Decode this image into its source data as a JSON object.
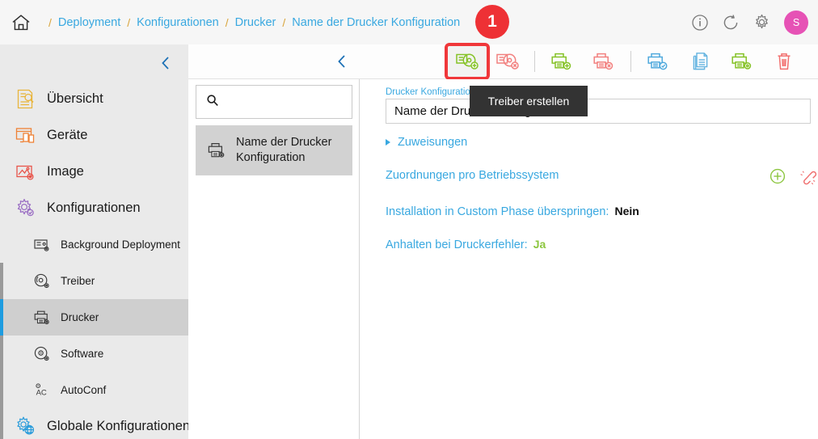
{
  "header": {
    "home_icon": "home-icon",
    "breadcrumb": [
      {
        "label": "Deployment"
      },
      {
        "label": "Konfigurationen"
      },
      {
        "label": "Drucker"
      },
      {
        "label": "Name der Drucker Konfiguration"
      }
    ],
    "separator": "/",
    "actions": [
      {
        "name": "info-icon",
        "title": "Info"
      },
      {
        "name": "refresh-icon",
        "title": "Refresh"
      },
      {
        "name": "gear-icon",
        "title": "Settings"
      }
    ],
    "avatar_initial": "S",
    "avatar_color": "#e652b5",
    "background": "#f6f6f6",
    "link_color": "#39a8e0",
    "separator_color": "#d9a43b"
  },
  "sidebar": {
    "collapse_icon": "chevron-left-icon",
    "background": "#eaeaea",
    "active_marker_color": "#1e9ce0",
    "items": [
      {
        "label": "Übersicht",
        "icon": "overview-document-search-icon",
        "color": "#e8b53c",
        "level": 1
      },
      {
        "label": "Geräte",
        "icon": "devices-monitor-icon",
        "color": "#ef8236",
        "level": 1
      },
      {
        "label": "Image",
        "icon": "image-picture-gear-icon",
        "color": "#e8544a",
        "level": 1
      },
      {
        "label": "Konfigurationen",
        "icon": "configurations-gear-icon",
        "color": "#9b6fc4",
        "level": 1
      }
    ],
    "subitems": [
      {
        "label": "Background Deployment",
        "icon": "background-deployment-icon",
        "active": false
      },
      {
        "label": "Treiber",
        "icon": "driver-disc-icon",
        "active": false
      },
      {
        "label": "Drucker",
        "icon": "printer-icon",
        "active": true
      },
      {
        "label": "Software",
        "icon": "software-disc-icon",
        "active": false
      },
      {
        "label": "AutoConf",
        "icon": "autoconf-ac-icon",
        "active": false
      }
    ],
    "footer_item": {
      "label": "Globale Konfigurationen",
      "icon": "global-configurations-globe-gear-icon",
      "color": "#2c9ddb"
    }
  },
  "list_panel": {
    "search": {
      "value": "",
      "placeholder": "",
      "icon": "search-icon"
    },
    "items": [
      {
        "label": "Name der Drucker Konfiguration",
        "icon": "printer-icon",
        "selected": true
      }
    ]
  },
  "content_toolbar": {
    "back_icon": "chevron-left-icon",
    "badge": "1",
    "badge_color": "#ee3135",
    "highlight_color": "#f0373a",
    "buttons": [
      {
        "name": "create-driver-button",
        "icon": "driver-disc-plus-icon",
        "color": "#85c226",
        "title": "Treiber erstellen",
        "highlighted": true
      },
      {
        "name": "delete-driver-button",
        "icon": "driver-disc-delete-icon",
        "color": "#f2807f",
        "title": "Treiber löschen",
        "highlighted": false
      },
      {
        "name": "add-printer-button",
        "icon": "printer-plus-icon",
        "color": "#85c226",
        "title": "Drucker hinzufügen",
        "highlighted": false
      },
      {
        "name": "delete-printer-button",
        "icon": "printer-delete-icon",
        "color": "#f2807f",
        "title": "Drucker löschen",
        "highlighted": false
      },
      {
        "name": "test-printer-button",
        "icon": "printer-check-icon",
        "color": "#4fa9dd",
        "title": "Drucker testen",
        "highlighted": false
      },
      {
        "name": "copy-document-button",
        "icon": "copy-documents-icon",
        "color": "#63b3e0",
        "title": "Kopieren",
        "highlighted": false
      },
      {
        "name": "printer-settings-button",
        "icon": "printer-gear-icon",
        "color": "#85c226",
        "title": "Drucker Einstellungen",
        "highlighted": false
      },
      {
        "name": "delete-button",
        "icon": "trash-icon",
        "color": "#f2706f",
        "title": "Löschen",
        "highlighted": false
      }
    ]
  },
  "tooltip": {
    "text": "Treiber erstellen",
    "background": "#333333"
  },
  "content": {
    "name_field": {
      "label": "Drucker Konfigurationsname",
      "value": "Name der Drucker Konfiguration",
      "placeholder": ""
    },
    "expand_row": {
      "label": "Zuweisungen",
      "icon": "triangle-right-icon",
      "expanded": false
    },
    "assignments_row": {
      "label": "Zuordnungen pro Betriebssystem",
      "icons": [
        {
          "name": "add-circle-icon",
          "color": "#8cc63f"
        },
        {
          "name": "unlink-icon",
          "color": "#ef6b6b"
        }
      ]
    },
    "properties": [
      {
        "key": "Installation in Custom Phase überspringen:",
        "value": "Nein",
        "value_color": "#111111"
      },
      {
        "key": "Anhalten bei Druckerfehler:",
        "value": "Ja",
        "value_color": "#8cc63f"
      }
    ]
  }
}
